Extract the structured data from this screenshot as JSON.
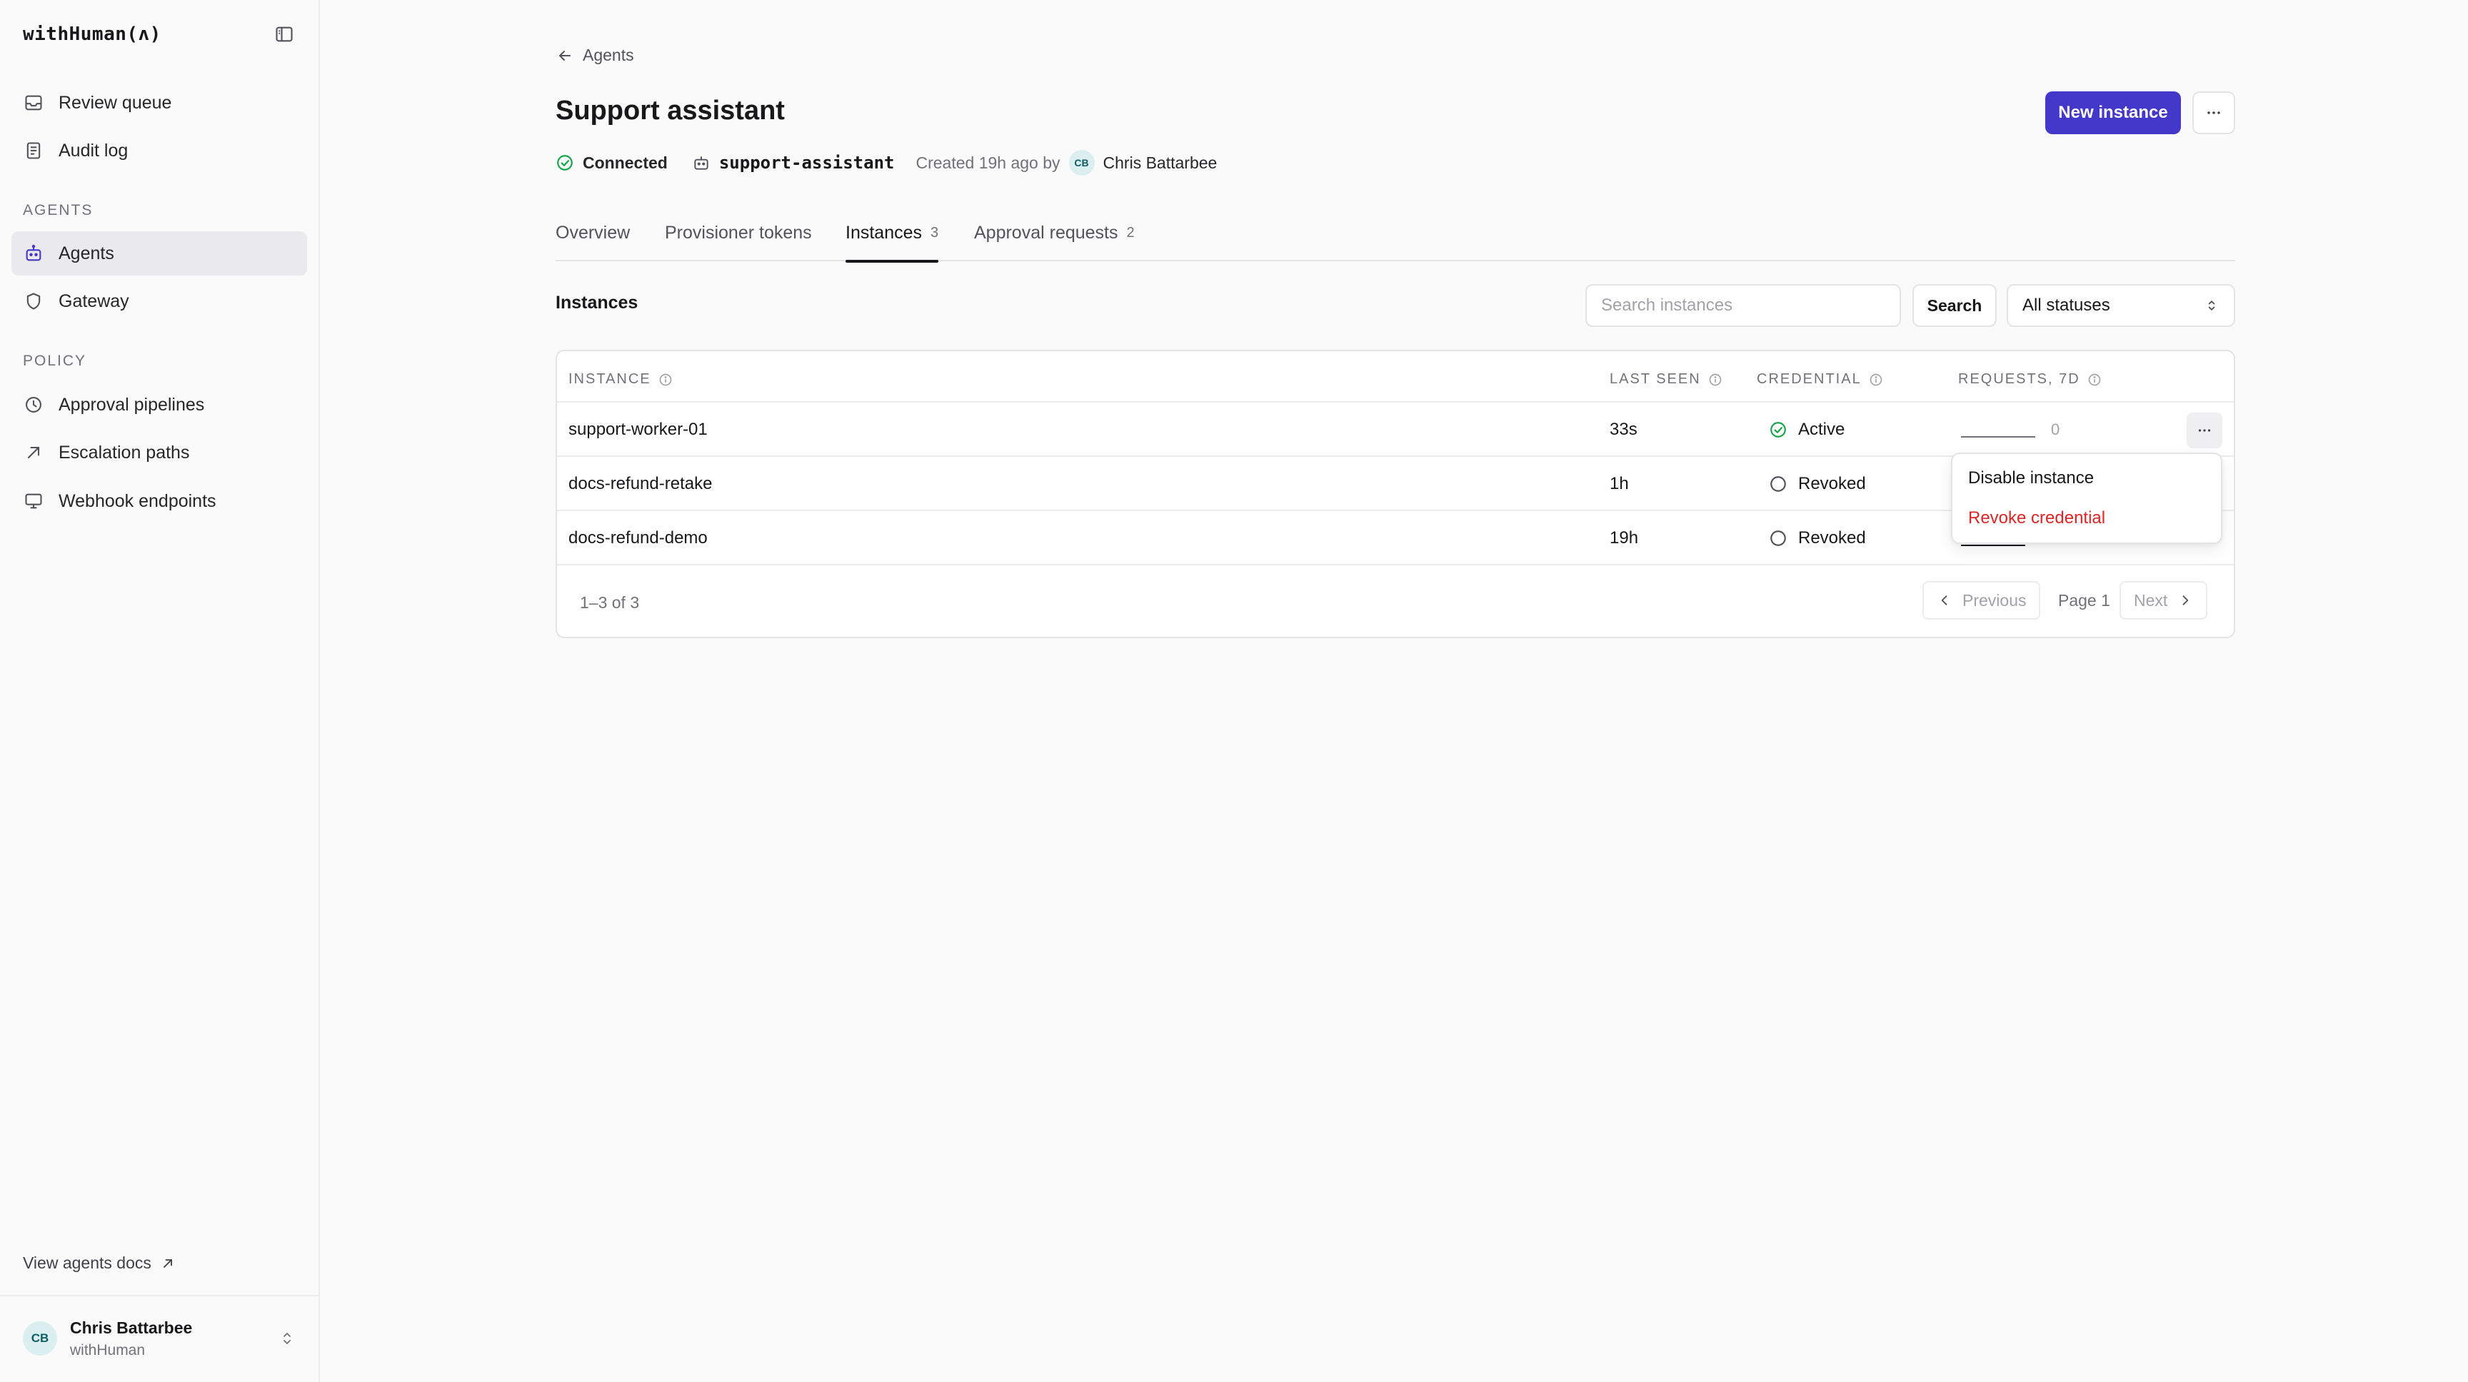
{
  "sidebar": {
    "brand": "withHuman(ʌ)",
    "top_items": [
      {
        "label": "Review queue",
        "icon": "inbox-icon"
      },
      {
        "label": "Audit log",
        "icon": "document-icon"
      }
    ],
    "sections": [
      {
        "title": "AGENTS",
        "items": [
          {
            "label": "Agents",
            "icon": "bot-icon",
            "active": true
          },
          {
            "label": "Gateway",
            "icon": "shield-icon"
          }
        ]
      },
      {
        "title": "POLICY",
        "items": [
          {
            "label": "Approval pipelines",
            "icon": "clock-icon"
          },
          {
            "label": "Escalation paths",
            "icon": "arrow-up-right-icon"
          },
          {
            "label": "Webhook endpoints",
            "icon": "monitor-icon"
          }
        ]
      }
    ],
    "docs_link": "View agents docs",
    "user": {
      "initials": "CB",
      "name": "Chris Battarbee",
      "org": "withHuman"
    }
  },
  "header": {
    "back_label": "Agents",
    "title": "Support assistant",
    "new_instance_label": "New instance",
    "status": "Connected",
    "slug": "support-assistant",
    "created": "Created 19h ago by",
    "author_initials": "CB",
    "author": "Chris Battarbee"
  },
  "tabs": [
    {
      "label": "Overview",
      "count": ""
    },
    {
      "label": "Provisioner tokens",
      "count": ""
    },
    {
      "label": "Instances",
      "count": "3",
      "active": true
    },
    {
      "label": "Approval requests",
      "count": "2"
    }
  ],
  "instances": {
    "title": "Instances",
    "search_placeholder": "Search instances",
    "search_label": "Search",
    "status_filter": "All statuses",
    "columns": [
      "INSTANCE",
      "LAST SEEN",
      "CREDENTIAL",
      "REQUESTS, 7D"
    ],
    "rows": [
      {
        "name": "support-worker-01",
        "last_seen": "33s",
        "credential": "Active",
        "requests": "0"
      },
      {
        "name": "docs-refund-retake",
        "last_seen": "1h",
        "credential": "Revoked",
        "requests": ""
      },
      {
        "name": "docs-refund-demo",
        "last_seen": "19h",
        "credential": "Revoked",
        "requests": ""
      }
    ],
    "footer": {
      "range": "1–3 of 3",
      "previous": "Previous",
      "page": "Page 1",
      "next": "Next"
    }
  },
  "row_menu": {
    "disable": "Disable instance",
    "revoke": "Revoke credential"
  },
  "colors": {
    "accent": "#4338ca",
    "success": "#16a34a",
    "danger": "#dc2626"
  }
}
